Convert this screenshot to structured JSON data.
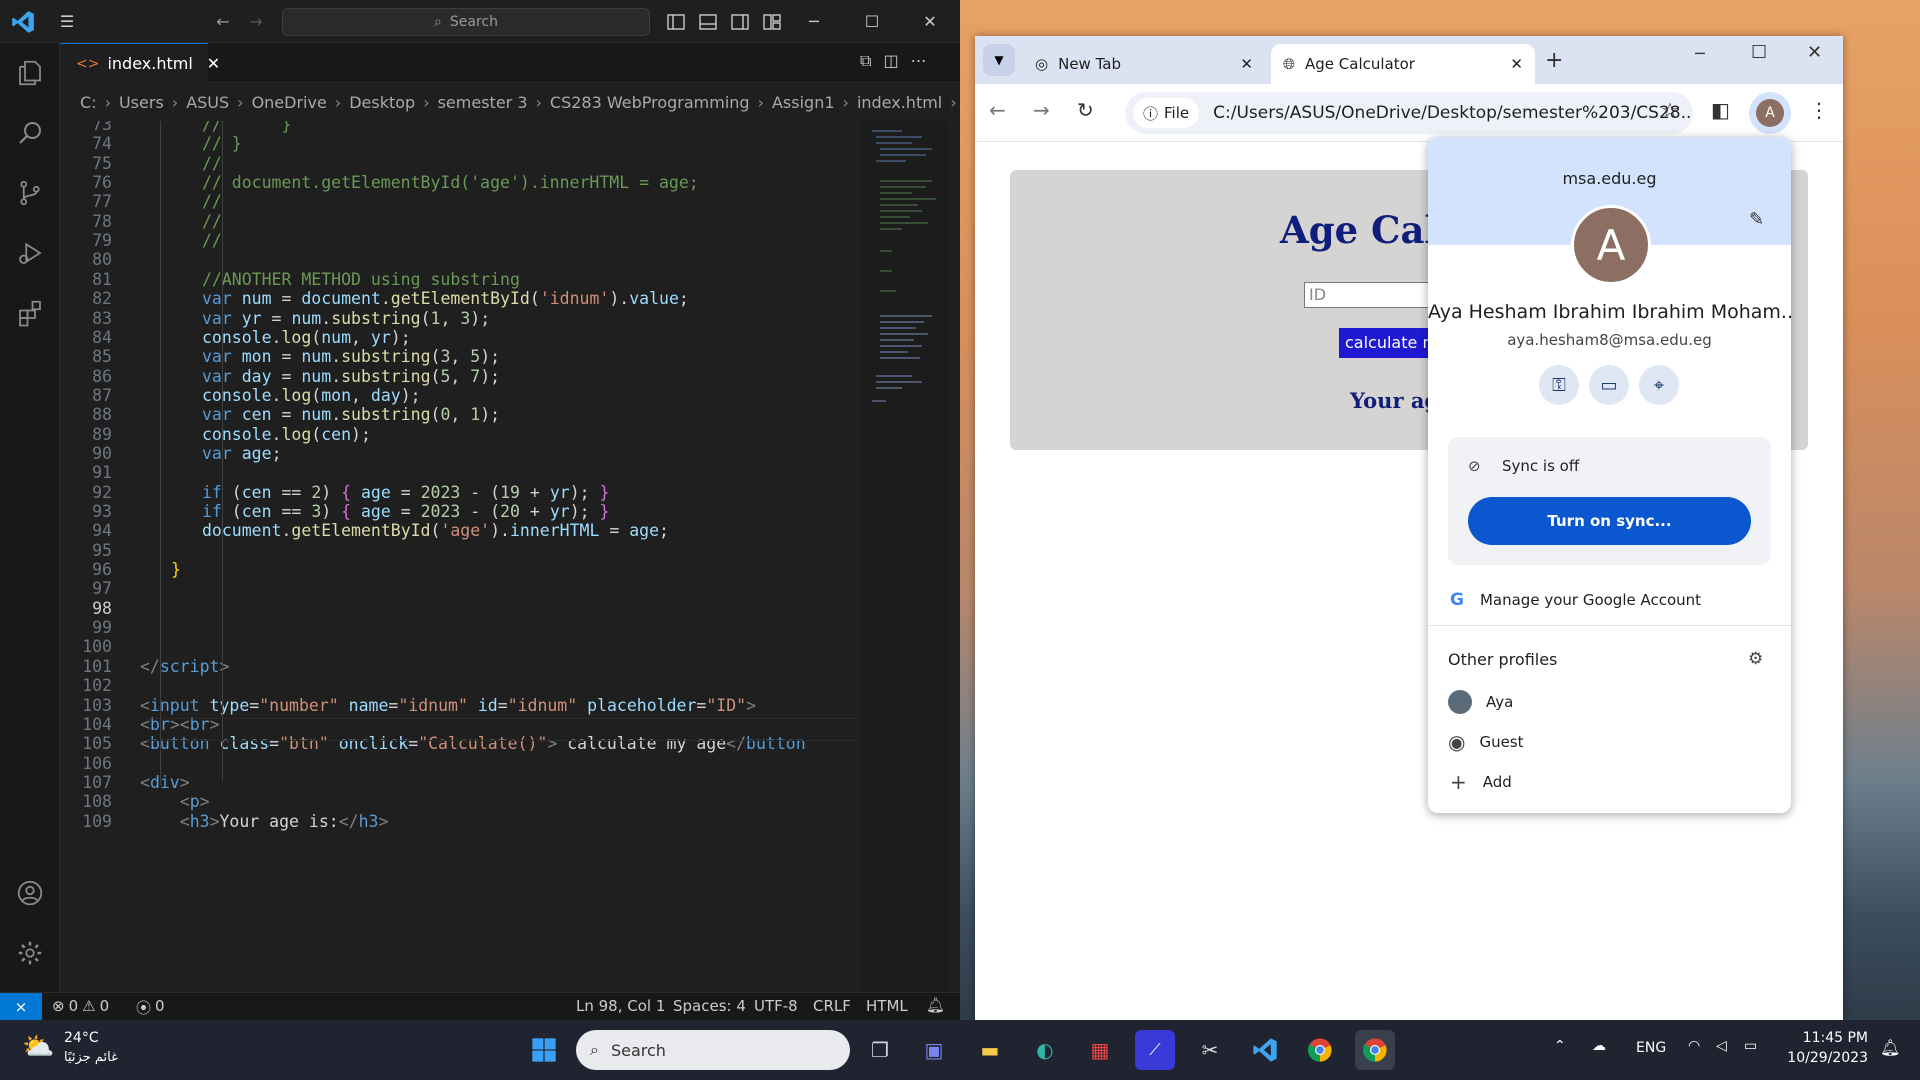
{
  "vscode": {
    "search_placeholder": "Search",
    "tab": {
      "filename": "index.html",
      "close": "✕"
    },
    "breadcrumb": [
      "C:",
      "Users",
      "ASUS",
      "OneDrive",
      "Desktop",
      "semester 3",
      "CS283 WebProgramming",
      "Assign1",
      "index.html",
      "html"
    ],
    "code_lines": [
      {
        "n": "73",
        "html": "<span class='cm'>//      }</span>"
      },
      {
        "n": "74",
        "html": "<span class='cm'>// }</span>"
      },
      {
        "n": "75",
        "html": "<span class='cm'>//</span>"
      },
      {
        "n": "76",
        "html": "<span class='cm'>// document.getElementById('age').innerHTML = age;</span>"
      },
      {
        "n": "77",
        "html": "<span class='cm'>//</span>"
      },
      {
        "n": "78",
        "html": "<span class='cm'>//</span>"
      },
      {
        "n": "79",
        "html": "<span class='cm'>//</span>"
      },
      {
        "n": "80",
        "html": ""
      },
      {
        "n": "81",
        "html": "<span class='cm'>//ANOTHER METHOD using substring</span>"
      },
      {
        "n": "82",
        "html": "<span class='kw'>var</span> <span class='vr'>num</span> = <span class='vr'>document</span>.<span class='fn'>getElementById</span>(<span class='st'>'idnum'</span>).<span class='vr'>value</span>;"
      },
      {
        "n": "83",
        "html": "<span class='kw'>var</span> <span class='vr'>yr</span> = <span class='vr'>num</span>.<span class='fn'>substring</span>(<span class='nu'>1</span>, <span class='nu'>3</span>);"
      },
      {
        "n": "84",
        "html": "<span class='vr'>console</span>.<span class='fn'>log</span>(<span class='vr'>num</span>, <span class='vr'>yr</span>);"
      },
      {
        "n": "85",
        "html": "<span class='kw'>var</span> <span class='vr'>mon</span> = <span class='vr'>num</span>.<span class='fn'>substring</span>(<span class='nu'>3</span>, <span class='nu'>5</span>);"
      },
      {
        "n": "86",
        "html": "<span class='kw'>var</span> <span class='vr'>day</span> = <span class='vr'>num</span>.<span class='fn'>substring</span>(<span class='nu'>5</span>, <span class='nu'>7</span>);"
      },
      {
        "n": "87",
        "html": "<span class='vr'>console</span>.<span class='fn'>log</span>(<span class='vr'>mon</span>, <span class='vr'>day</span>);"
      },
      {
        "n": "88",
        "html": "<span class='kw'>var</span> <span class='vr'>cen</span> = <span class='vr'>num</span>.<span class='fn'>substring</span>(<span class='nu'>0</span>, <span class='nu'>1</span>);"
      },
      {
        "n": "89",
        "html": "<span class='vr'>console</span>.<span class='fn'>log</span>(<span class='vr'>cen</span>);"
      },
      {
        "n": "90",
        "html": "<span class='kw'>var</span> <span class='vr'>age</span>;"
      },
      {
        "n": "91",
        "html": ""
      },
      {
        "n": "92",
        "html": "<span class='kw'>if</span> (<span class='vr'>cen</span> == <span class='nu'>2</span>) <span class='br2'>{</span> <span class='vr'>age</span> = <span class='nu'>2023</span> - (<span class='nu'>19</span> + <span class='vr'>yr</span>); <span class='br2'>}</span>"
      },
      {
        "n": "93",
        "html": "<span class='kw'>if</span> (<span class='vr'>cen</span> == <span class='nu'>3</span>) <span class='br2'>{</span> <span class='vr'>age</span> = <span class='nu'>2023</span> - (<span class='nu'>20</span> + <span class='vr'>yr</span>); <span class='br2'>}</span>"
      },
      {
        "n": "94",
        "html": "<span class='vr'>document</span>.<span class='fn'>getElementById</span>(<span class='st'>'age'</span>).<span class='vr'>innerHTML</span> = <span class='vr'>age</span>;"
      },
      {
        "n": "95",
        "html": ""
      },
      {
        "n": "96",
        "html": "<span class='br'>}</span>"
      },
      {
        "n": "97",
        "html": ""
      },
      {
        "n": "98",
        "html": ""
      },
      {
        "n": "99",
        "html": ""
      },
      {
        "n": "100",
        "html": ""
      },
      {
        "n": "101",
        "html": "<span class='pn'>&lt;/</span><span class='tg'>script</span><span class='pn'>&gt;</span>"
      },
      {
        "n": "102",
        "html": ""
      },
      {
        "n": "103",
        "html": "<span class='pn'>&lt;</span><span class='tg'>input</span> <span class='at'>type</span>=<span class='st'>\"number\"</span> <span class='at'>name</span>=<span class='st'>\"idnum\"</span> <span class='at'>id</span>=<span class='st'>\"idnum\"</span> <span class='at'>placeholder</span>=<span class='st'>\"ID\"</span><span class='pn'>&gt;</span>"
      },
      {
        "n": "104",
        "html": "<span class='pn'>&lt;</span><span class='tg'>br</span><span class='pn'>&gt;&lt;</span><span class='tg'>br</span><span class='pn'>&gt;</span>"
      },
      {
        "n": "105",
        "html": "<span class='pn'>&lt;</span><span class='tg'>button</span> <span class='at'>class</span>=<span class='st'>\"btn\"</span> <span class='at'>onclick</span>=<span class='st'>\"Calculate()\"</span><span class='pn'>&gt;</span> calculate my age<span class='pn'>&lt;/</span><span class='tg'>button</span>"
      },
      {
        "n": "106",
        "html": ""
      },
      {
        "n": "107",
        "html": "<span class='pn'>&lt;</span><span class='tg'>div</span><span class='pn'>&gt;</span>"
      },
      {
        "n": "108",
        "html": "    <span class='pn'>&lt;</span><span class='tg'>p</span><span class='pn'>&gt;</span>"
      },
      {
        "n": "109",
        "html": "    <span class='pn'>&lt;</span><span class='tg'>h3</span><span class='pn'>&gt;</span>Your age is:<span class='pn'>&lt;/</span><span class='tg'>h3</span><span class='pn'>&gt;</span>"
      }
    ],
    "status": {
      "errors": "0",
      "warnings": "0",
      "ports": "0",
      "position": "Ln 98, Col 1",
      "spaces": "Spaces: 4",
      "encoding": "UTF-8",
      "eol": "CRLF",
      "language": "HTML"
    }
  },
  "chrome": {
    "tabs": [
      {
        "title": "New Tab"
      },
      {
        "title": "Age Calculator"
      }
    ],
    "url_chip": "File",
    "url": "C:/Users/ASUS/OneDrive/Desktop/semester%203/CS28...",
    "page": {
      "heading": "Age Calc",
      "input_placeholder": "ID",
      "button": "calculate m",
      "result": "Your ag"
    },
    "profile": {
      "domain": "msa.edu.eg",
      "avatar_letter": "A",
      "toolbar_avatar_letter": "A",
      "name": "Aya Hesham Ibrahim Ibrahim Moham...",
      "email": "aya.hesham8@msa.edu.eg",
      "sync_status": "Sync is off",
      "sync_button": "Turn on sync...",
      "manage_account": "Manage your Google Account",
      "other_profiles_title": "Other profiles",
      "other_profiles": [
        "Aya",
        "Guest"
      ],
      "add": "Add"
    }
  },
  "taskbar": {
    "weather_temp": "24°C",
    "weather_text": "غائم جزئيًا",
    "search": "Search",
    "lang": "ENG",
    "time": "11:45 PM",
    "date": "10/29/2023"
  },
  "colors": {
    "vscode_bg": "#1f1f1f",
    "accent_blue": "#0b57d0",
    "page_button": "#1f19d1",
    "heading_navy": "#0f1e7a"
  }
}
